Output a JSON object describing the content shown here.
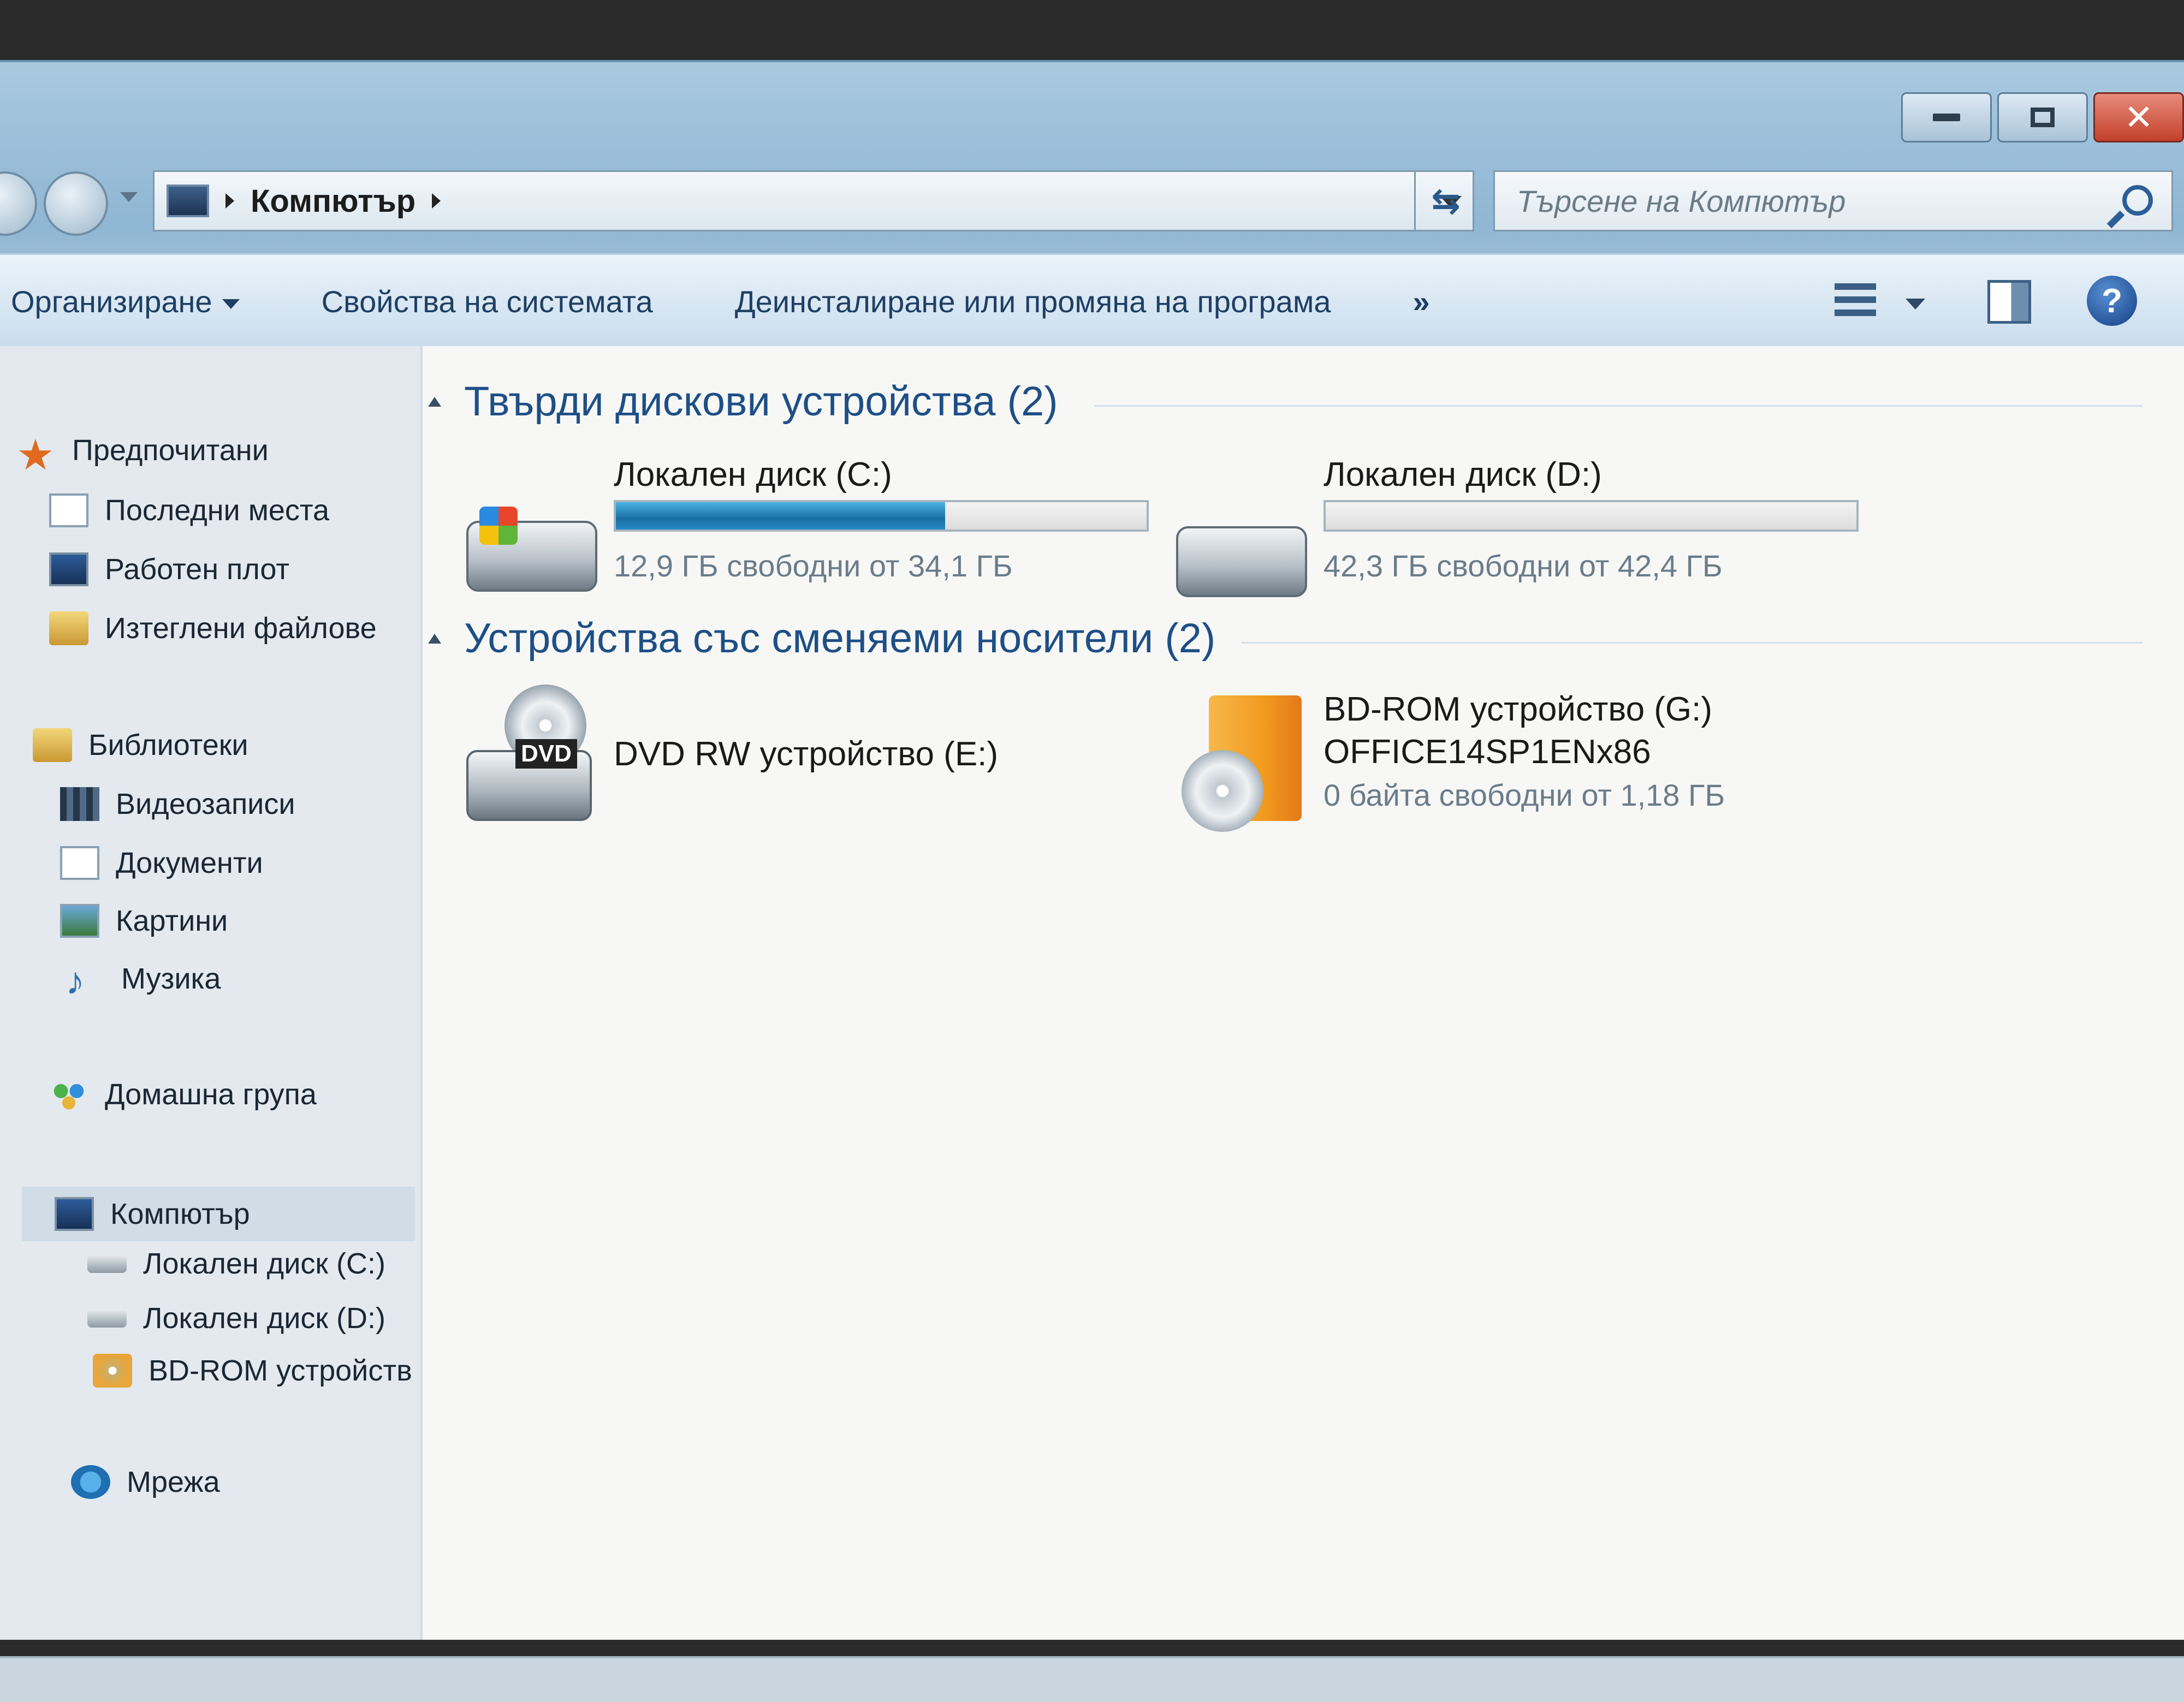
{
  "window": {
    "caption_buttons": [
      "minimize",
      "maximize",
      "close"
    ]
  },
  "address_bar": {
    "location": "Компютър",
    "icon": "computer-icon"
  },
  "search": {
    "placeholder": "Търсене на Компютър"
  },
  "command_bar": {
    "organize": "Организиране",
    "system_properties": "Свойства на системата",
    "uninstall": "Деинсталиране или промяна на програма",
    "more": "»"
  },
  "nav_pane": {
    "favorites": {
      "header": "Предпочитани",
      "items": [
        "Последни места",
        "Работен плот",
        "Изтеглени файлове"
      ]
    },
    "libraries": {
      "header": "Библиотеки",
      "items": [
        "Видеозаписи",
        "Документи",
        "Картини",
        "Музика"
      ]
    },
    "homegroup": "Домашна група",
    "computer": {
      "header": "Компютър",
      "items": [
        "Локален диск (C:)",
        "Локален диск (D:)",
        "BD-ROM устройств"
      ]
    },
    "network": "Мрежа"
  },
  "content": {
    "hard_disks": {
      "header": "Твърди дискови устройства (2)",
      "drives": [
        {
          "name": "Локален диск (C:)",
          "free": "12,9 ГБ свободни от 34,1 ГБ",
          "used_fraction": 0.62
        },
        {
          "name": "Локален диск (D:)",
          "free": "42,3 ГБ свободни от 42,4 ГБ",
          "used_fraction": 0.0
        }
      ]
    },
    "removable": {
      "header": "Устройства със сменяеми носители (2)",
      "devices": [
        {
          "name": "DVD RW устройство (E:)",
          "label": "DVD"
        },
        {
          "name": "BD-ROM устройство (G:)",
          "volume": "OFFICE14SP1ENx86",
          "free": "0 байта свободни от 1,18 ГБ"
        }
      ]
    }
  }
}
